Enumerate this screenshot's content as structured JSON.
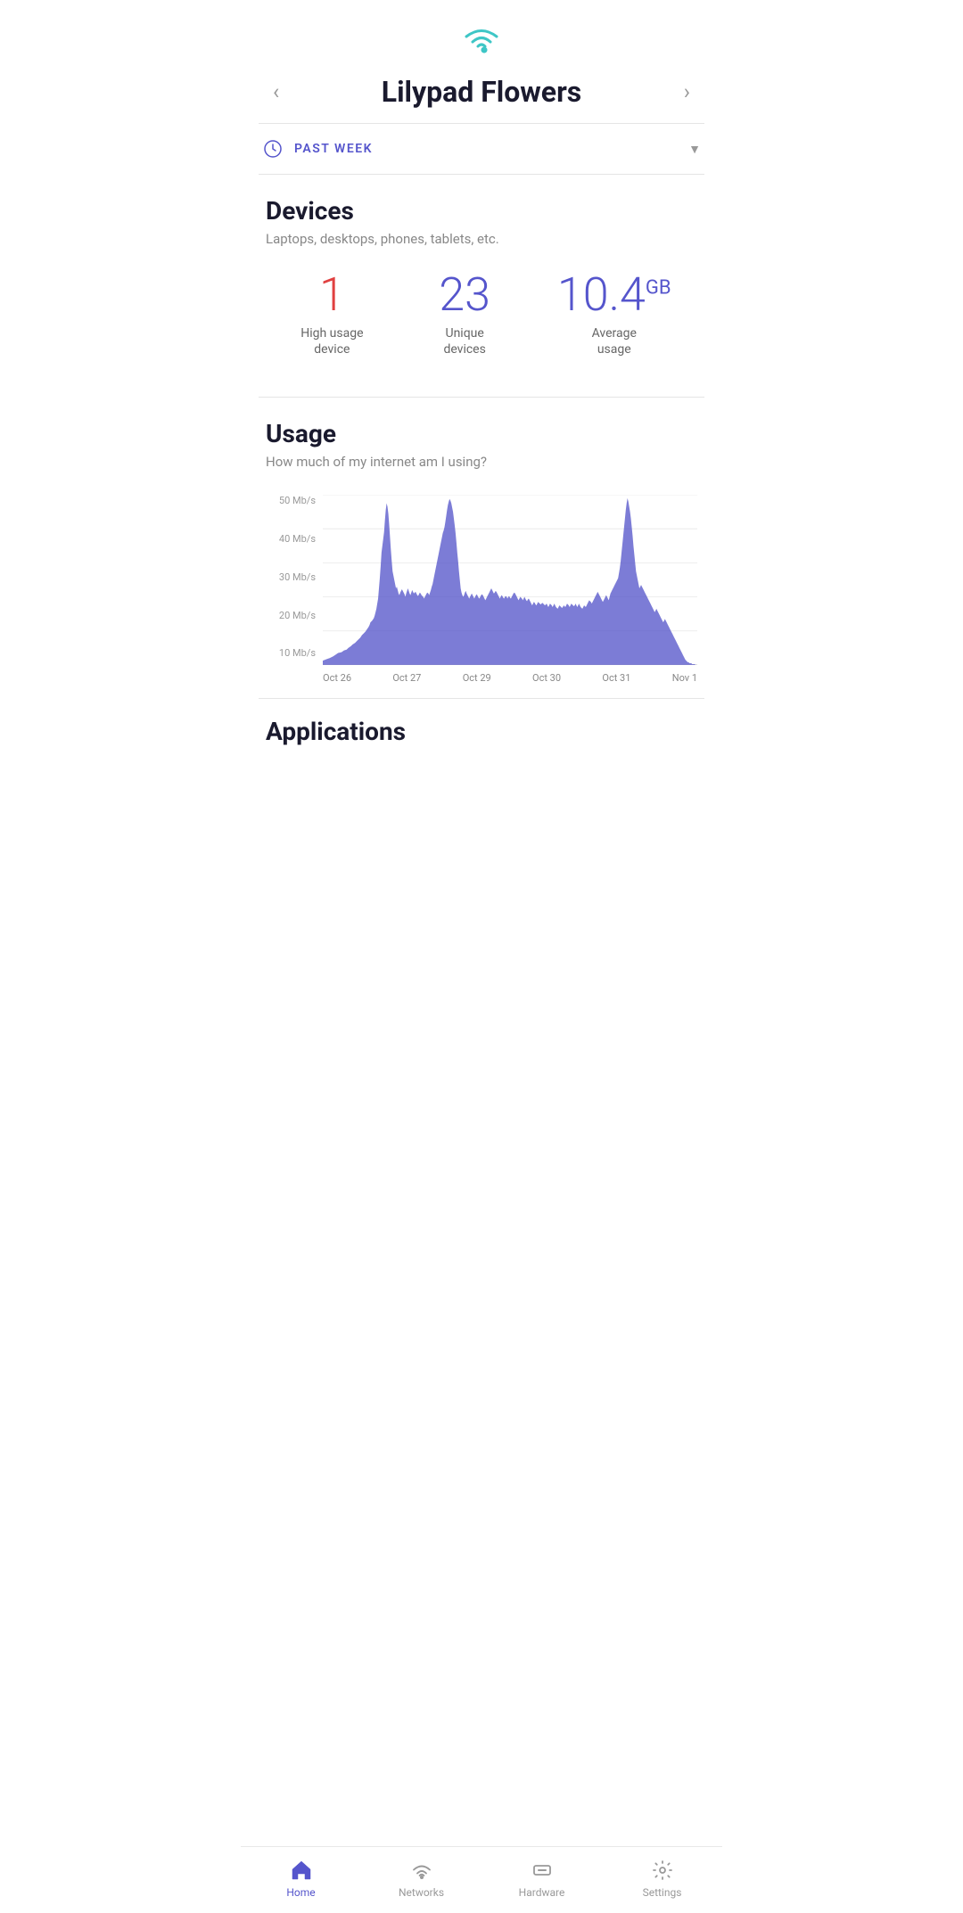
{
  "header": {
    "title": "Lilypad Flowers",
    "nav_left": "‹",
    "nav_right": "›"
  },
  "period": {
    "label": "PAST WEEK"
  },
  "devices": {
    "section_title": "Devices",
    "section_subtitle": "Laptops, desktops, phones, tablets, etc.",
    "stats": [
      {
        "value": "1",
        "unit": "",
        "label": "High usage device",
        "color": "red"
      },
      {
        "value": "23",
        "unit": "",
        "label": "Unique devices",
        "color": "purple"
      },
      {
        "value": "10.4",
        "unit": "GB",
        "label": "Average usage",
        "color": "purple"
      }
    ]
  },
  "usage": {
    "section_title": "Usage",
    "section_subtitle": "How much of my internet am I using?",
    "y_labels": [
      "10 Mb/s",
      "20 Mb/s",
      "30 Mb/s",
      "40 Mb/s",
      "50 Mb/s"
    ],
    "x_labels": [
      "Oct 26",
      "Oct 27",
      "Oct 29",
      "Oct 30",
      "Oct 31",
      "Nov 1"
    ]
  },
  "applications": {
    "section_title": "Applications"
  },
  "bottom_nav": {
    "items": [
      {
        "label": "Home",
        "active": true,
        "icon": "home"
      },
      {
        "label": "Networks",
        "active": false,
        "icon": "wifi"
      },
      {
        "label": "Hardware",
        "active": false,
        "icon": "hardware"
      },
      {
        "label": "Settings",
        "active": false,
        "icon": "settings"
      }
    ]
  }
}
